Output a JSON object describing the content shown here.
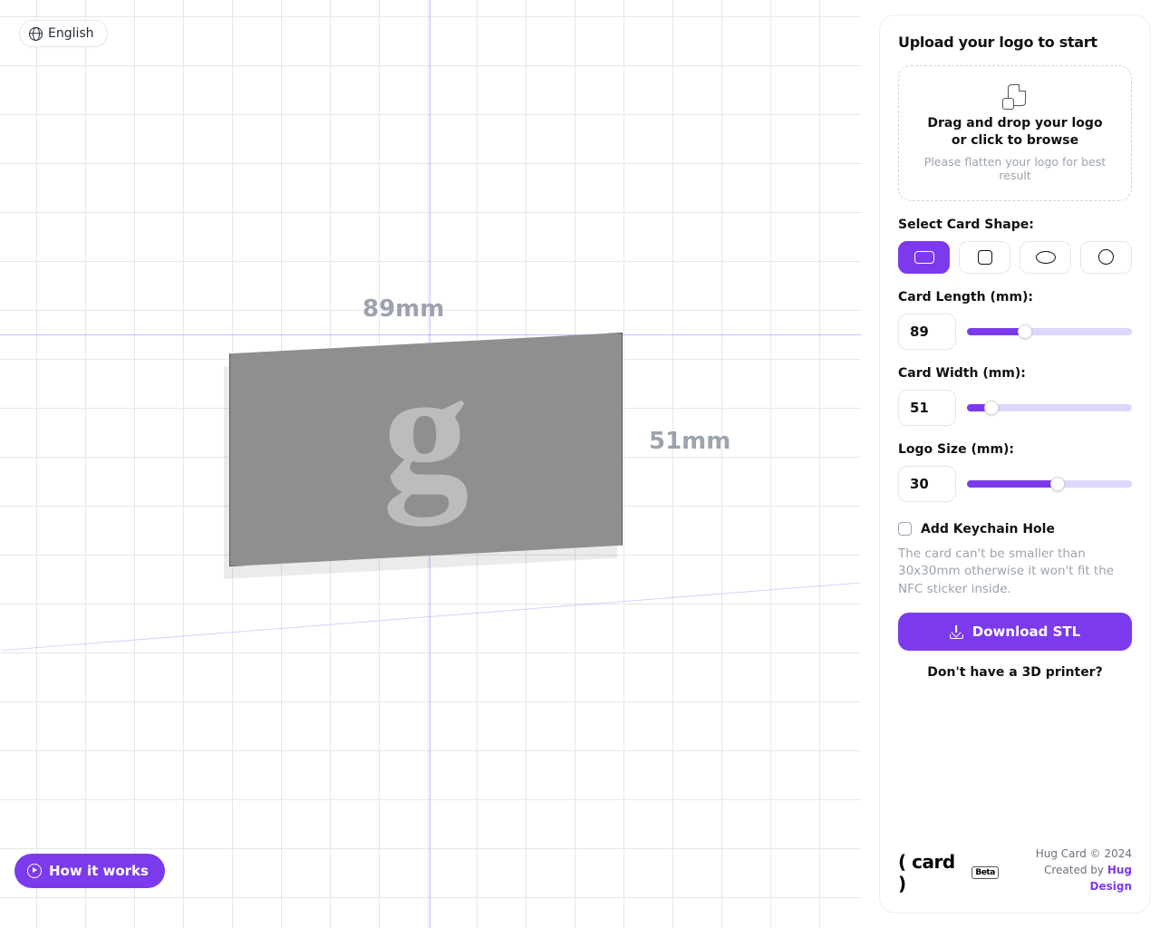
{
  "lang": {
    "label": "English"
  },
  "canvas": {
    "length_label": "89mm",
    "width_label": "51mm",
    "logo_letter": "g"
  },
  "how": {
    "label": "How it works"
  },
  "sidebar": {
    "title": "Upload your logo to start",
    "drop_main": "Drag and drop your logo or click to browse",
    "drop_sub": "Please flatten your logo for best result",
    "shape_label": "Select Card Shape:",
    "length_label": "Card Length (mm):",
    "length_value": "89",
    "width_label": "Card Width (mm):",
    "width_value": "51",
    "logo_label": "Logo Size (mm):",
    "logo_value": "30",
    "keychain_label": "Add Keychain Hole",
    "note": "The card can't be smaller than 30x30mm otherwise it won't fit the NFC sticker inside.",
    "download_label": "Download STL",
    "noprinter_label": "Don't have a 3D printer?"
  },
  "footer": {
    "brand": "( card )",
    "beta": "Beta",
    "copyright": "Hug Card © 2024",
    "created": "Created by ",
    "link": "Hug Design"
  },
  "sliders": {
    "length_pct": 35,
    "width_pct": 15,
    "logo_pct": 55
  }
}
